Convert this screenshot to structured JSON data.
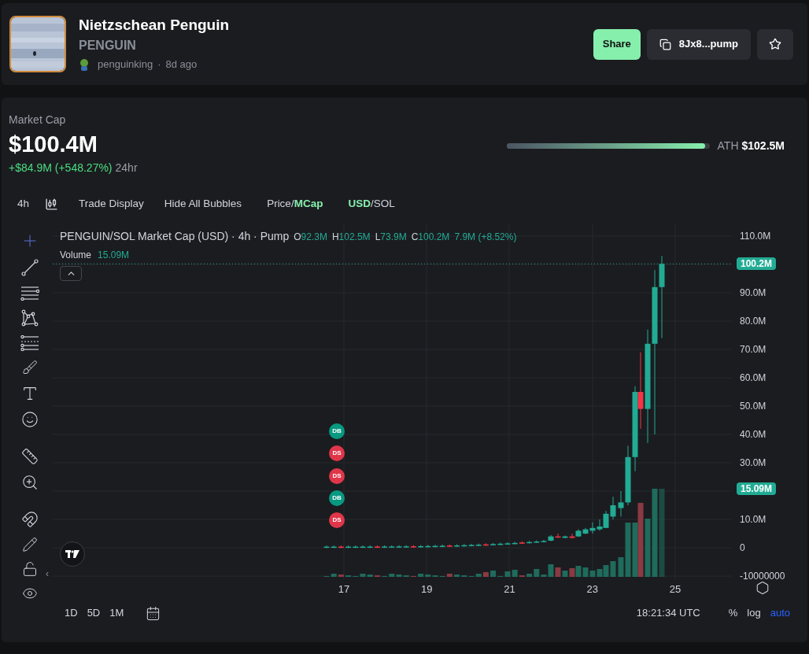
{
  "token": {
    "name": "Nietzschean Penguin",
    "ticker": "PENGUIN",
    "creator": "penguinking",
    "separator": "·",
    "age": "8d ago"
  },
  "actions": {
    "share": "Share",
    "address": "8Jx8...pump"
  },
  "market_cap": {
    "label": "Market Cap",
    "value": "$100.4M",
    "change": "+$84.9M (+548.27%)",
    "period": "24hr",
    "ath_label": "ATH",
    "ath_value": "$102.5M",
    "level": 0.98
  },
  "toolbar": {
    "interval": "4h",
    "items": [
      "Trade Display",
      "Hide All Bubbles"
    ],
    "separator": "/",
    "toggles": [
      {
        "options": [
          {
            "label": "Price",
            "selected": false
          },
          {
            "label": "MCap",
            "selected": true
          }
        ]
      },
      {
        "options": [
          {
            "label": "USD",
            "selected": true
          },
          {
            "label": "SOL",
            "selected": false
          }
        ]
      }
    ]
  },
  "legend": {
    "title": "PENGUIN/SOL Market Cap (USD) · 4h · Pump",
    "ohlc": [
      {
        "key": "O",
        "value": "92.3M"
      },
      {
        "key": "H",
        "value": "102.5M"
      },
      {
        "key": "L",
        "value": "73.9M"
      },
      {
        "key": "C",
        "value": "100.2M"
      }
    ],
    "change": "7.9M (+8.52%)",
    "volume_label": "Volume",
    "volume_value": "15.09M"
  },
  "markers": [
    {
      "label": "DB",
      "color": "#089981"
    },
    {
      "label": "DS",
      "color": "#e0364a"
    },
    {
      "label": "DS",
      "color": "#e0364a"
    },
    {
      "label": "DB",
      "color": "#089981"
    },
    {
      "label": "DS",
      "color": "#e0364a"
    }
  ],
  "y_axis": [
    "110.0M",
    "90.0M",
    "80.0M",
    "70.0M",
    "60.0M",
    "50.0M",
    "40.0M",
    "30.0M",
    "10.0M",
    "0",
    "-10000000"
  ],
  "x_axis": [
    "17",
    "19",
    "21",
    "23",
    "25"
  ],
  "price_tags": [
    {
      "label": "100.2M",
      "kind": "price"
    },
    {
      "label": "15.09M",
      "kind": "volume"
    }
  ],
  "side_arrow": "‹",
  "ranges": [
    "1D",
    "5D",
    "1M"
  ],
  "clock": "18:21:34 UTC",
  "scale_options": [
    {
      "label": "%",
      "selected": false
    },
    {
      "label": "log",
      "selected": false
    },
    {
      "label": "auto",
      "selected": true
    }
  ]
}
